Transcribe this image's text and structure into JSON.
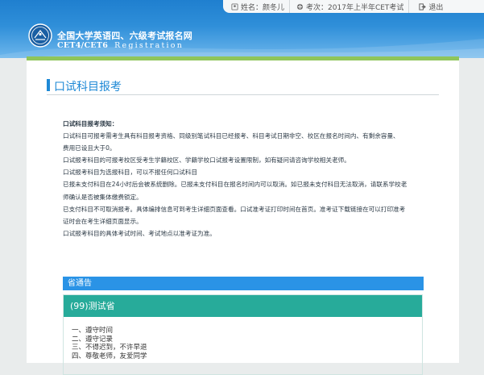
{
  "header": {
    "site_title": "全国大学英语四、六级考试报名网",
    "site_subtitle": "CET4/CET6",
    "site_subtitle_reg": "Registration",
    "user_label": "姓名：",
    "user_name": "颜冬儿",
    "exam_label": "考次：",
    "exam_name": "2017年上半年CET考试",
    "logout_label": "退出"
  },
  "page": {
    "title": "口试科目报考"
  },
  "notice": {
    "heading": "口试科目报考须知：",
    "lines": [
      "口试科目可报考需考生具有科目报考资格、同级别笔试科目已经报考、科目考试日期非空、校区在报名时间内、有剩余容量、",
      "费用已设且大于0。",
      "口试报考科目的可报考校区受考生学籍校区、学籍学校口试报考设置限制，如有疑问请咨询学校相关老师。",
      "口试报考科目为选报科目，可以不报任何口试科目",
      "已报未支付科目在24小时后会被系统删除。已报未支付科目在报名时间内可以取消。如已报未支付科目无法取消，请联系学校老",
      "师确认是否被集体缴费锁定。",
      "已支付科目不可取消报考。具体编排信息可到考生详细页面查看。口试准考证打印时间在首页。准考证下载链接在可以打印准考",
      "证时会在考生详细页面显示。",
      "口试报考科目的具体考试时间、考试地点以准考证为准。"
    ]
  },
  "province_bar": {
    "label": "省通告"
  },
  "exam_box": {
    "heading": "(99)测试省",
    "rules": [
      "一、遵守时间",
      "二、遵守记录",
      "三、不得迟到，不许早退",
      "四、尊敬老师，友爱同学"
    ]
  },
  "colors": {
    "header_blue": "#1f7fcf",
    "accent_green": "#8fc55b",
    "title_blue": "#1e89d6",
    "province_bar": "#2a93e6",
    "exam_head": "#27ab9a"
  }
}
